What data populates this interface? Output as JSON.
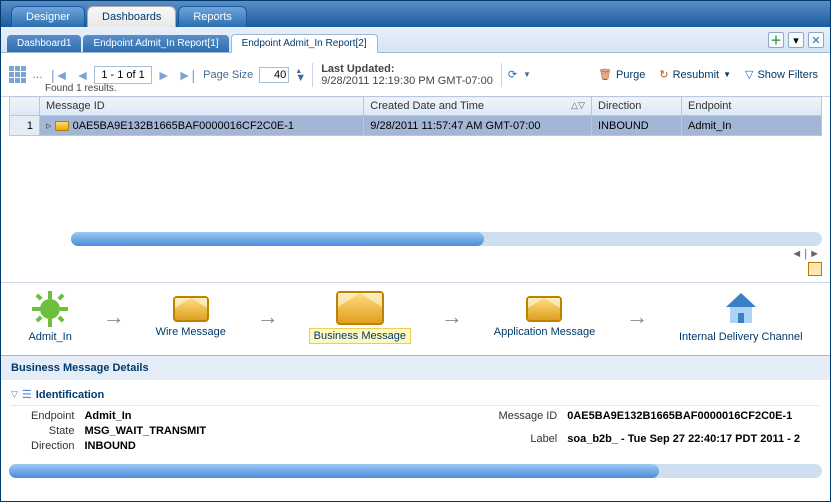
{
  "topTabs": {
    "designer": "Designer",
    "dashboards": "Dashboards",
    "reports": "Reports"
  },
  "subTabs": {
    "t1": "Dashboard1",
    "t2": "Endpoint Admit_In Report[1]",
    "t3": "Endpoint Admit_In Report[2]"
  },
  "toolbar": {
    "pagerRange": "1 - 1 of 1",
    "pageSizeLabel": "Page Size",
    "pageSizeValue": "40",
    "lastUpdatedLabel": "Last Updated:",
    "lastUpdatedValue": "9/28/2011 12:19:30 PM GMT-07:00",
    "purge": "Purge",
    "resubmit": "Resubmit",
    "showFilters": "Show Filters",
    "foundResults": "Found 1 results."
  },
  "table": {
    "headers": {
      "msgId": "Message ID",
      "created": "Created Date and Time",
      "direction": "Direction",
      "endpoint": "Endpoint"
    },
    "row": {
      "num": "1",
      "msgId": "0AE5BA9E132B1665BAF0000016CF2C0E-1",
      "created": "9/28/2011 11:57:47 AM GMT-07:00",
      "direction": "INBOUND",
      "endpoint": "Admit_In"
    }
  },
  "flow": {
    "admitIn": "Admit_In",
    "wire": "Wire Message",
    "business": "Business Message",
    "app": "Application Message",
    "idc": "Internal Delivery Channel"
  },
  "detailsTitle": "Business Message Details",
  "identification": {
    "title": "Identification",
    "endpointLabel": "Endpoint",
    "endpointValue": "Admit_In",
    "stateLabel": "State",
    "stateValue": "MSG_WAIT_TRANSMIT",
    "directionLabel": "Direction",
    "directionValue": "INBOUND",
    "msgIdLabel": "Message ID",
    "msgIdValue": "0AE5BA9E132B1665BAF0000016CF2C0E-1",
    "labelLabel": "Label",
    "labelValue": "soa_b2b_ - Tue Sep 27 22:40:17 PDT 2011 - 2"
  }
}
